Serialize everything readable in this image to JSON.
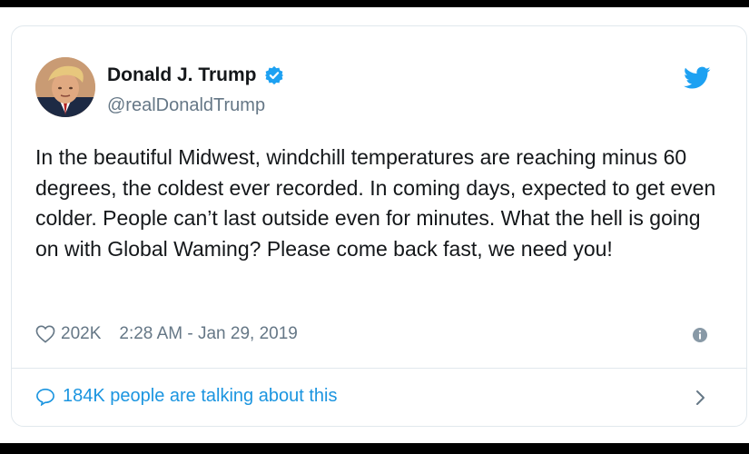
{
  "tweet": {
    "author_name": "Donald J. Trump",
    "handle": "@realDonaldTrump",
    "text": "In the beautiful Midwest, windchill temperatures are reaching minus 60 degrees, the coldest ever recorded. In coming days, expected to get even colder. People can’t last outside even for minutes. What the hell is going on with Global Waming? Please come back fast, we need you!",
    "likes": "202K",
    "timestamp": "2:28 AM - Jan 29, 2019",
    "talking_about": "184K people are talking about this"
  },
  "icons": {
    "verified": "verified-badge-icon",
    "brand": "twitter-bird-icon",
    "like": "heart-icon",
    "info": "info-icon",
    "reply": "speech-bubble-icon",
    "more": "chevron-right-icon"
  },
  "colors": {
    "brand_blue": "#1da1f2",
    "link_blue": "#1b95e0",
    "text_primary": "#14171a",
    "text_secondary": "#657786",
    "border": "#e1e8ed"
  }
}
